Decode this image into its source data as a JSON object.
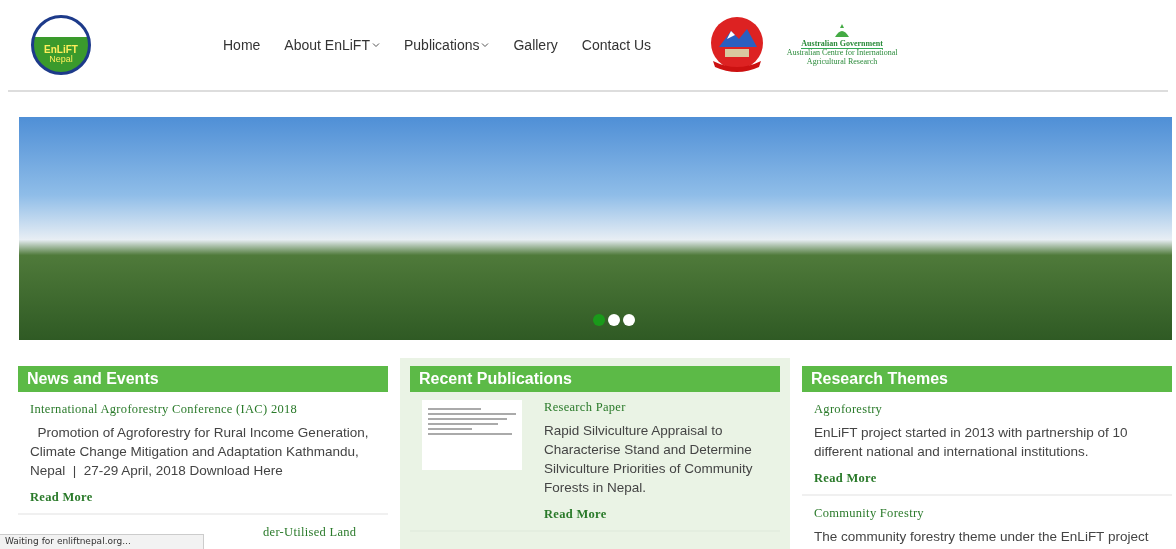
{
  "header": {
    "logo": {
      "title": "EnLiFT",
      "subtitle": "Nepal"
    },
    "nav": [
      {
        "label": "Home",
        "dropdown": false
      },
      {
        "label": "About EnLiFT",
        "dropdown": true
      },
      {
        "label": "Publications",
        "dropdown": true
      },
      {
        "label": "Gallery",
        "dropdown": false
      },
      {
        "label": "Contact Us",
        "dropdown": false
      }
    ],
    "partner_logo": {
      "title": "Australian Government",
      "subtitle": "Australian Centre for International Agricultural Research"
    }
  },
  "slider": {
    "dots": [
      {
        "selected": true
      },
      {
        "selected": false
      },
      {
        "selected": false
      }
    ]
  },
  "news": {
    "title": "News and Events",
    "items": [
      {
        "title": "International Agroforestry Conference (IAC) 2018",
        "text": "  Promotion of Agroforestry for Rural Income Generation, Climate Change Mitigation and Adaptation Kathmandu, Nepal  |  27-29 April, 2018 Download Here",
        "link": "Read More"
      },
      {
        "title": "der-Utilised Land"
      }
    ]
  },
  "publications": {
    "title": "Recent Publications",
    "items": [
      {
        "type": "Research Paper",
        "text": "Rapid Silviculture Appraisal to Characterise Stand and Determine Silviculture Priorities of Community Forests in Nepal.",
        "link": "Read More"
      }
    ]
  },
  "themes": {
    "title": "Research Themes",
    "items": [
      {
        "title": "Agroforestry",
        "text": "EnLiFT project started in 2013 with partnership of 10 different national and international institutions.",
        "link": "Read More"
      },
      {
        "title": "Community Forestry",
        "text": "The community forestry theme under the EnLiFT project"
      }
    ]
  },
  "status_bar": "Waiting for enliftnepal.org..."
}
